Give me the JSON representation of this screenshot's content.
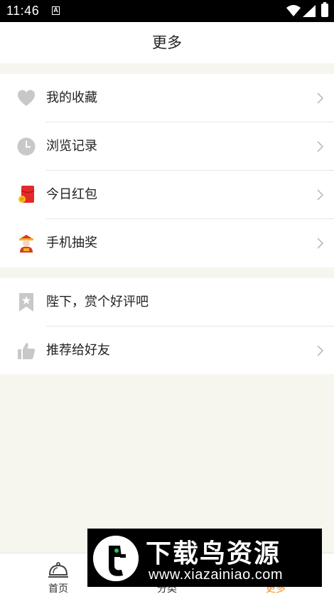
{
  "status": {
    "time": "11:46",
    "notif_glyph": "A"
  },
  "header": {
    "title": "更多"
  },
  "group1": [
    {
      "label": "我的收藏",
      "icon": "heart-icon"
    },
    {
      "label": "浏览记录",
      "icon": "clock-icon"
    },
    {
      "label": "今日红包",
      "icon": "red-envelope-icon"
    },
    {
      "label": "手机抽奖",
      "icon": "fortune-god-icon"
    }
  ],
  "group2": [
    {
      "label": "陛下，赏个好评吧",
      "icon": "star-bookmark-icon"
    },
    {
      "label": "推荐给好友",
      "icon": "thumbs-up-icon"
    }
  ],
  "tabs": [
    {
      "label": "首页",
      "icon": "home-cloche-icon"
    },
    {
      "label": "分类",
      "icon": "category-icon"
    },
    {
      "label": "更多",
      "icon": "more-icon",
      "active": true
    }
  ],
  "watermark": {
    "title": "下载鸟资源",
    "url": "www.xiazainiao.com"
  },
  "colors": {
    "accent": "#f08a1e",
    "background": "#f6f5ee",
    "icon_gray": "#c8c8c8"
  }
}
